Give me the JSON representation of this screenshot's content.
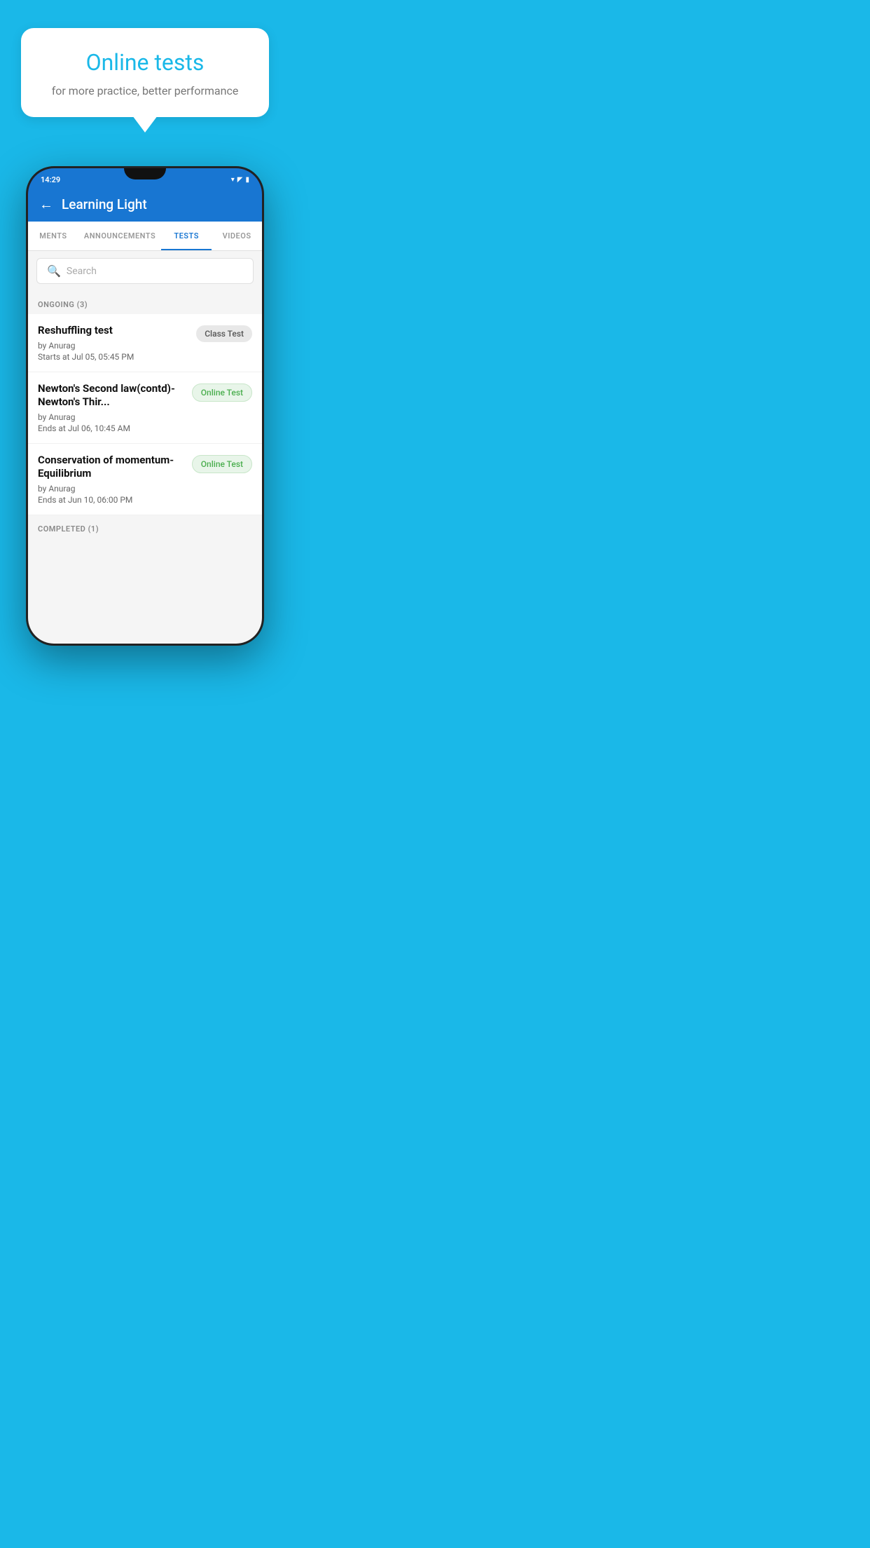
{
  "hero": {
    "title": "Online tests",
    "subtitle": "for more practice, better performance"
  },
  "phone": {
    "time": "14:29",
    "app_title": "Learning Light",
    "back_label": "←",
    "tabs": [
      {
        "label": "MENTS",
        "active": false
      },
      {
        "label": "ANNOUNCEMENTS",
        "active": false
      },
      {
        "label": "TESTS",
        "active": true
      },
      {
        "label": "VIDEOS",
        "active": false
      }
    ],
    "search": {
      "placeholder": "Search"
    },
    "ongoing_label": "ONGOING (3)",
    "tests": [
      {
        "name": "Reshuffling test",
        "by": "by Anurag",
        "date": "Starts at  Jul 05, 05:45 PM",
        "badge": "Class Test",
        "badge_type": "class"
      },
      {
        "name": "Newton's Second law(contd)-Newton's Thir...",
        "by": "by Anurag",
        "date": "Ends at  Jul 06, 10:45 AM",
        "badge": "Online Test",
        "badge_type": "online"
      },
      {
        "name": "Conservation of momentum-Equilibrium",
        "by": "by Anurag",
        "date": "Ends at  Jun 10, 06:00 PM",
        "badge": "Online Test",
        "badge_type": "online"
      }
    ],
    "completed_label": "COMPLETED (1)"
  }
}
